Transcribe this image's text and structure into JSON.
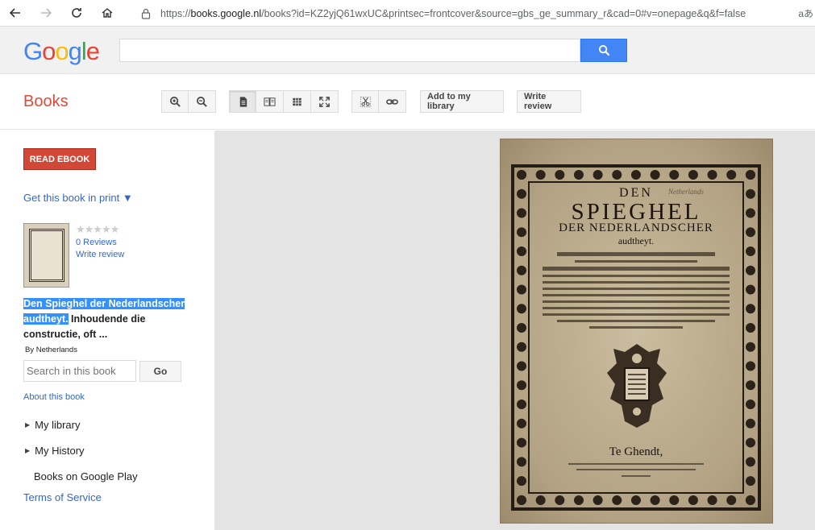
{
  "browser": {
    "url_prefix": "https://",
    "url_domain": "books.google.nl",
    "url_rest": "/books?id=KZ2yjQ61wxUC&printsec=frontcover&source=gbs_ge_summary_r&cad=0#v=onepage&q&f=false",
    "reader_label": "aあ"
  },
  "header": {
    "logo_letters": [
      "G",
      "o",
      "o",
      "g",
      "l",
      "e"
    ],
    "search_value": ""
  },
  "toolbar": {
    "section_title": "Books",
    "add_library_label": "Add to my library",
    "write_review_label": "Write review"
  },
  "sidebar": {
    "read_ebook_label": "READ EBOOK",
    "get_print_label": "Get this book in print ▼",
    "stars": "★★★★★",
    "reviews_label": "0 Reviews",
    "write_review_label": "Write review",
    "book_title_highlighted": "Den Spieghel der Nederlandscher audtheyt.",
    "book_title_rest": " Inhoudende die constructie, oft ...",
    "by_label": "By Netherlands",
    "search_placeholder": "Search in this book",
    "go_label": "Go",
    "about_label": "About this book",
    "my_library_label": "My library",
    "my_history_label": "My History",
    "books_play_label": "Books on Google Play",
    "terms_label": "Terms of Service"
  },
  "book_page": {
    "line1": "DEN",
    "line2": "SPIEGHEL",
    "line3": "DER NEDERLANDSCHER",
    "line4": "audtheyt.",
    "place": "Te Ghendt,",
    "hand_note": "Netherlands"
  }
}
